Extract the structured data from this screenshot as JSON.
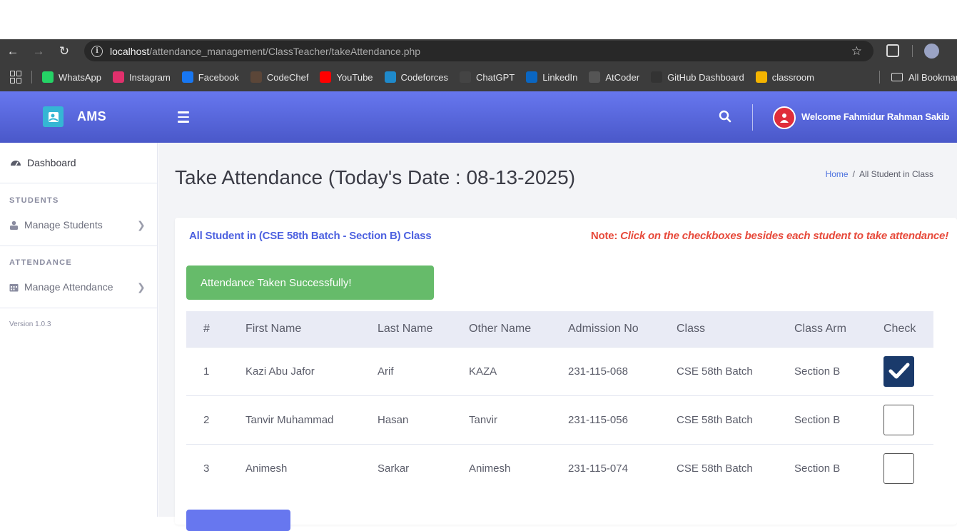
{
  "browser": {
    "url_host": "localhost",
    "url_path": "/attendance_management/ClassTeacher/takeAttendance.php",
    "bookmarks": [
      {
        "label": "WhatsApp",
        "icon": "whatsapp-icon",
        "color": "#25d366"
      },
      {
        "label": "Instagram",
        "icon": "instagram-icon",
        "color": "#e1306c"
      },
      {
        "label": "Facebook",
        "icon": "facebook-icon",
        "color": "#1877f2"
      },
      {
        "label": "CodeChef",
        "icon": "codechef-icon",
        "color": "#5b4638"
      },
      {
        "label": "YouTube",
        "icon": "youtube-icon",
        "color": "#ff0000"
      },
      {
        "label": "Codeforces",
        "icon": "codeforces-icon",
        "color": "#1f8acb"
      },
      {
        "label": "ChatGPT",
        "icon": "chatgpt-icon",
        "color": "#444444"
      },
      {
        "label": "LinkedIn",
        "icon": "linkedin-icon",
        "color": "#0a66c2"
      },
      {
        "label": "AtCoder",
        "icon": "atcoder-icon",
        "color": "#555555"
      },
      {
        "label": "GitHub Dashboard",
        "icon": "github-icon",
        "color": "#333333"
      },
      {
        "label": "classroom",
        "icon": "classroom-icon",
        "color": "#f4b400"
      }
    ],
    "all_bookmarks": "All Bookmarks"
  },
  "header": {
    "brand": "AMS",
    "welcome": "Welcome Fahmidur Rahman Sakib",
    "accent": "#6777ef"
  },
  "sidebar": {
    "dashboard": "Dashboard",
    "students_heading": "STUDENTS",
    "manage_students": "Manage Students",
    "attendance_heading": "ATTENDANCE",
    "manage_attendance": "Manage Attendance",
    "version": "Version 1.0.3"
  },
  "main": {
    "title": "Take Attendance (Today's Date : 08-13-2025)",
    "breadcrumb_home": "Home",
    "breadcrumb_sep": "/",
    "breadcrumb_current": "All Student in Class",
    "card_title": "All Student in (CSE 58th Batch - Section B) Class",
    "note_label": "Note: ",
    "note_text": "Click on the checkboxes besides each student to take attendance!",
    "alert": "Attendance Taken Successfully!"
  },
  "table": {
    "headers": [
      "#",
      "First Name",
      "Last Name",
      "Other Name",
      "Admission No",
      "Class",
      "Class Arm",
      "Check"
    ],
    "rows": [
      {
        "num": "1",
        "first": "Kazi Abu Jafor",
        "last": "Arif",
        "other": "KAZA",
        "adm": "231-115-068",
        "class": "CSE 58th Batch",
        "arm": "Section B",
        "checked": true
      },
      {
        "num": "2",
        "first": "Tanvir Muhammad",
        "last": "Hasan",
        "other": "Tanvir",
        "adm": "231-115-056",
        "class": "CSE 58th Batch",
        "arm": "Section B",
        "checked": false
      },
      {
        "num": "3",
        "first": "Animesh",
        "last": "Sarkar",
        "other": "Animesh",
        "adm": "231-115-074",
        "class": "CSE 58th Batch",
        "arm": "Section B",
        "checked": false
      }
    ]
  }
}
